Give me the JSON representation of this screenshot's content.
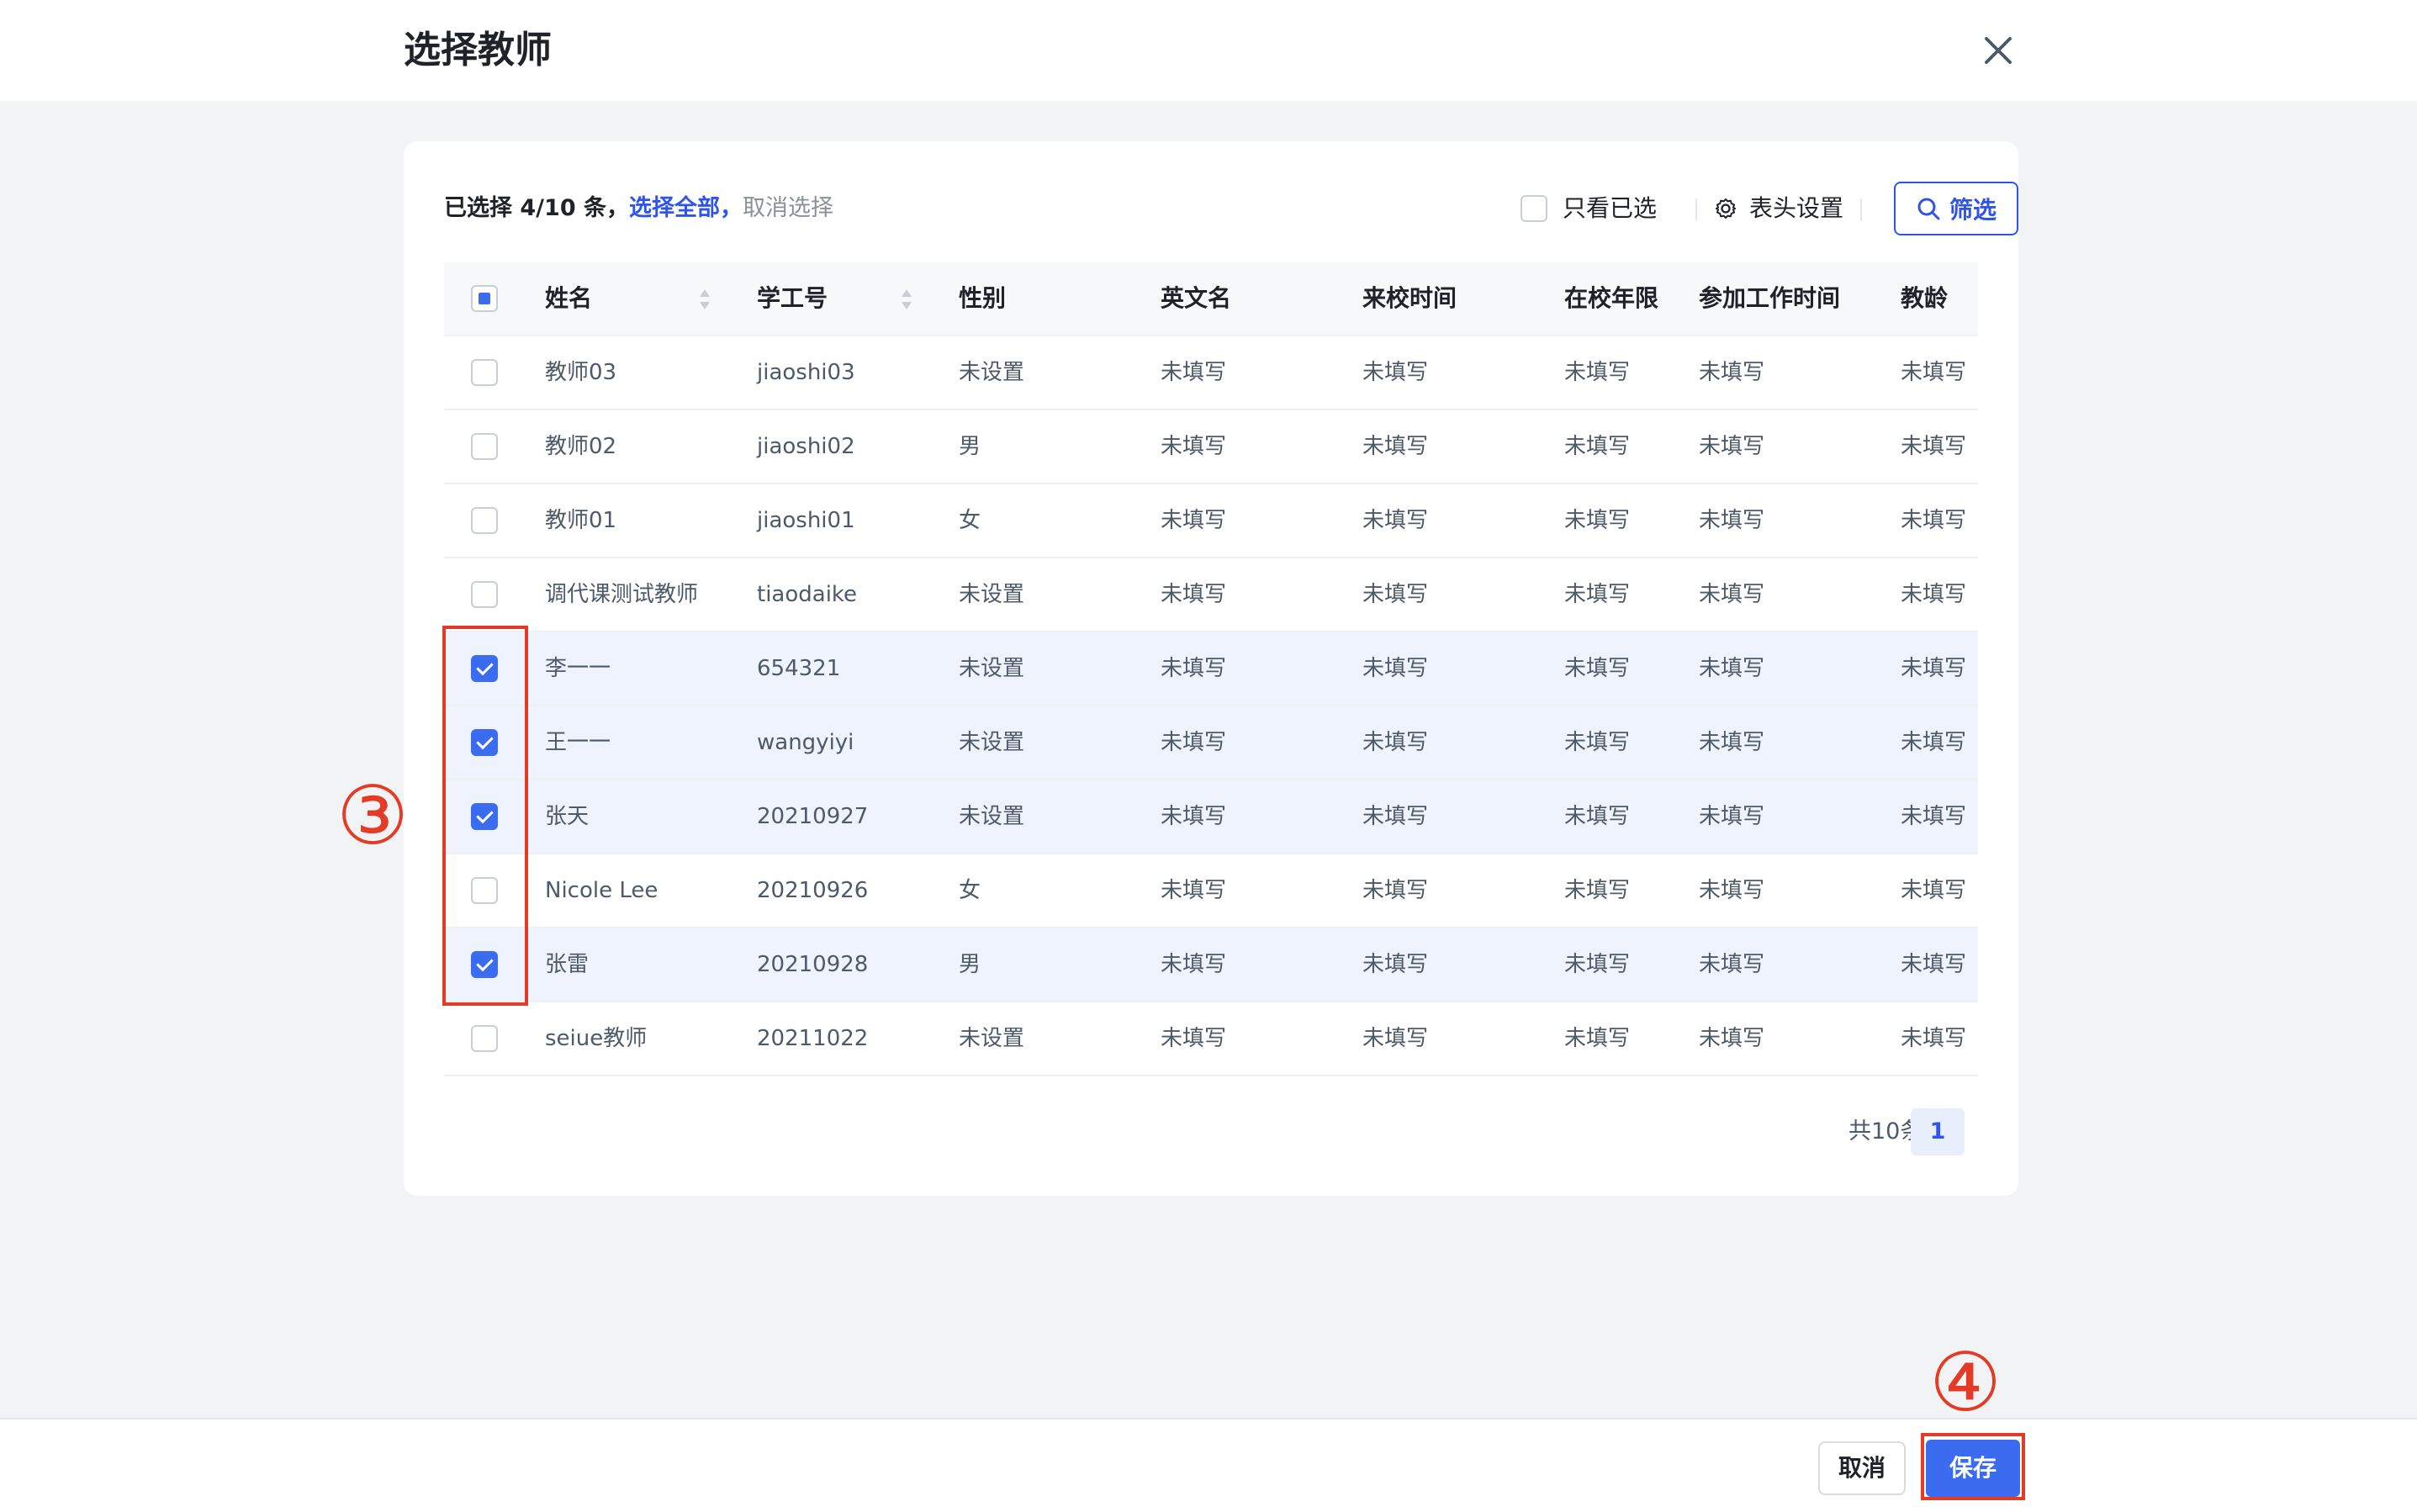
{
  "dialog": {
    "title": "选择教师"
  },
  "toolbar": {
    "selected_summary": "已选择 4/10 条，",
    "select_all": "选择全部，",
    "clear_selection": "取消选择",
    "only_selected_label": "只看已选",
    "column_settings_label": "表头设置",
    "filter_label": "筛选"
  },
  "table": {
    "header_checkbox": "partial",
    "columns": [
      "姓名",
      "学工号",
      "性别",
      "英文名",
      "来校时间",
      "在校年限",
      "参加工作时间",
      "教龄"
    ],
    "rows": [
      {
        "checked": false,
        "name": "教师03",
        "id": "jiaoshi03",
        "gender": "未设置",
        "en": "未填写",
        "date": "未填写",
        "years": "未填写",
        "work": "未填写",
        "teach": "未填写"
      },
      {
        "checked": false,
        "name": "教师02",
        "id": "jiaoshi02",
        "gender": "男",
        "en": "未填写",
        "date": "未填写",
        "years": "未填写",
        "work": "未填写",
        "teach": "未填写"
      },
      {
        "checked": false,
        "name": "教师01",
        "id": "jiaoshi01",
        "gender": "女",
        "en": "未填写",
        "date": "未填写",
        "years": "未填写",
        "work": "未填写",
        "teach": "未填写"
      },
      {
        "checked": false,
        "name": "调代课测试教师",
        "id": "tiaodaike",
        "gender": "未设置",
        "en": "未填写",
        "date": "未填写",
        "years": "未填写",
        "work": "未填写",
        "teach": "未填写"
      },
      {
        "checked": true,
        "name": "李一一",
        "id": "654321",
        "gender": "未设置",
        "en": "未填写",
        "date": "未填写",
        "years": "未填写",
        "work": "未填写",
        "teach": "未填写"
      },
      {
        "checked": true,
        "name": "王一一",
        "id": "wangyiyi",
        "gender": "未设置",
        "en": "未填写",
        "date": "未填写",
        "years": "未填写",
        "work": "未填写",
        "teach": "未填写"
      },
      {
        "checked": true,
        "name": "张天",
        "id": "20210927",
        "gender": "未设置",
        "en": "未填写",
        "date": "未填写",
        "years": "未填写",
        "work": "未填写",
        "teach": "未填写"
      },
      {
        "checked": false,
        "name": "Nicole Lee",
        "id": "20210926",
        "gender": "女",
        "en": "未填写",
        "date": "未填写",
        "years": "未填写",
        "work": "未填写",
        "teach": "未填写"
      },
      {
        "checked": true,
        "name": "张雷",
        "id": "20210928",
        "gender": "男",
        "en": "未填写",
        "date": "未填写",
        "years": "未填写",
        "work": "未填写",
        "teach": "未填写"
      },
      {
        "checked": false,
        "name": "seiue教师",
        "id": "20211022",
        "gender": "未设置",
        "en": "未填写",
        "date": "未填写",
        "years": "未填写",
        "work": "未填写",
        "teach": "未填写"
      }
    ]
  },
  "pagination": {
    "total": "共10条",
    "current_page": "1"
  },
  "footer": {
    "cancel_label": "取消",
    "save_label": "保存"
  },
  "annotations": {
    "step3": "③",
    "step4": "④"
  },
  "colors": {
    "accent": "#2f54eb",
    "checkbox": "#3b6cf0",
    "annotation": "#e33b25",
    "selected_row": "#eef3fd"
  },
  "icons": {
    "close": "close-icon",
    "settings": "gear-icon",
    "filter": "search-icon",
    "sort": "sort-icon"
  }
}
